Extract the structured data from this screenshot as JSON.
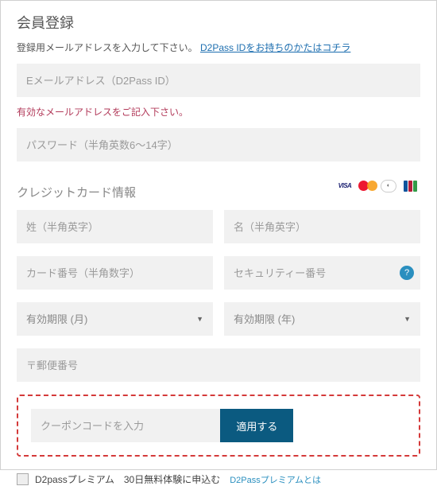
{
  "heading": "会員登録",
  "help_prefix": "登録用メールアドレスを入力して下さい。",
  "help_link": "D2Pass IDをお持ちのかたはコチラ",
  "email_placeholder": "Eメールアドレス（D2Pass ID）",
  "email_error": "有効なメールアドレスをご記入下さい。",
  "password_placeholder": "パスワード（半角英数6～14字）",
  "cc_heading": "クレジットカード情報",
  "icons": {
    "visa": "VISA"
  },
  "lastname_placeholder": "姓（半角英字）",
  "firstname_placeholder": "名（半角英字）",
  "cardnum_placeholder": "カード番号（半角数字）",
  "cvv_placeholder": "セキュリティー番号",
  "exp_month_label": "有効期限 (月)",
  "exp_year_label": "有効期限 (年)",
  "postal_placeholder": "〒郵便番号",
  "coupon_placeholder": "クーポンコードを入力",
  "apply_label": "適用する",
  "premium_label": "D2passプレミアム　30日無料体験に申込む",
  "premium_link": "D2Passプレミアムとは"
}
